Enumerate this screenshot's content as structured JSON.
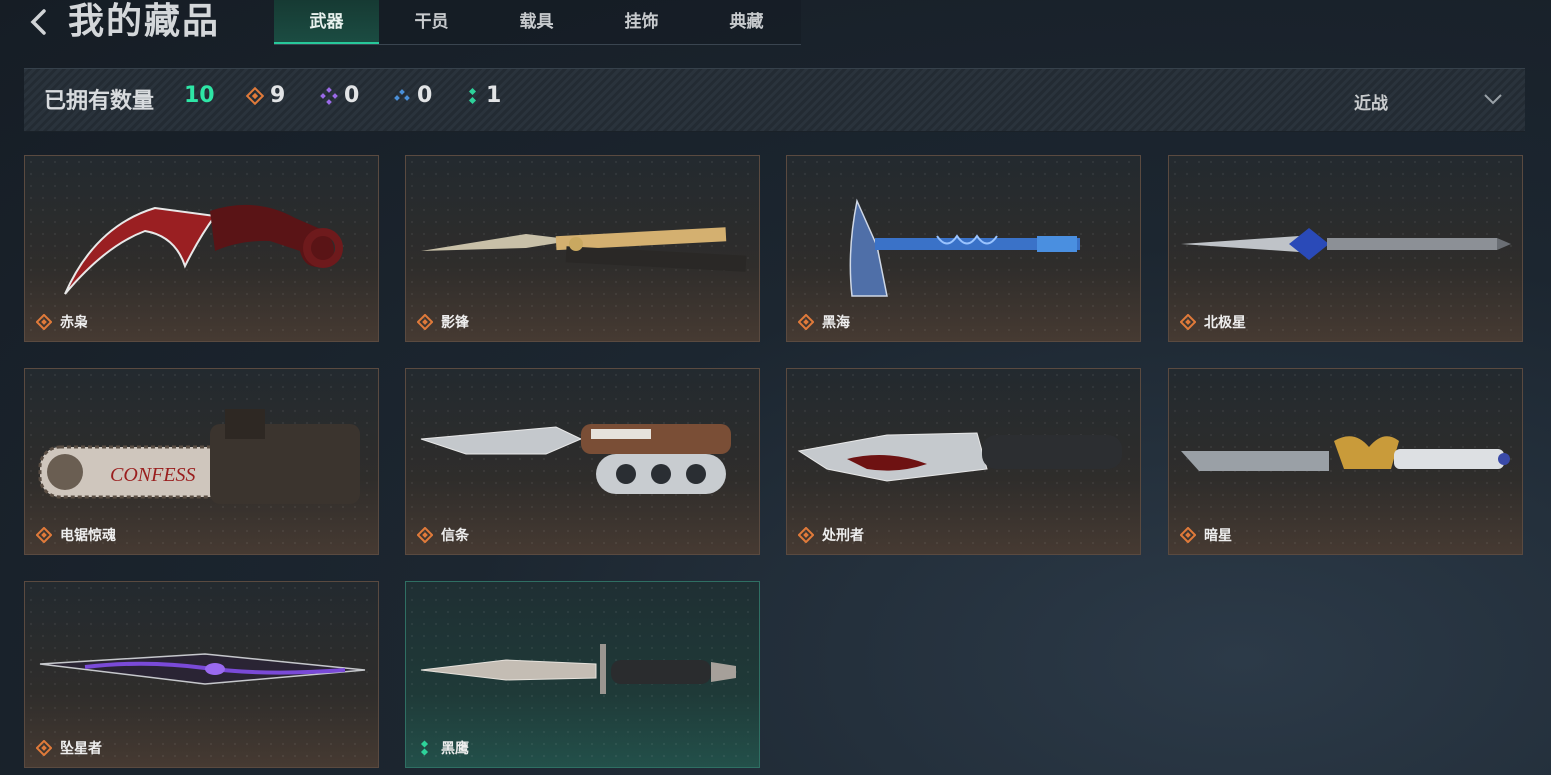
{
  "header": {
    "title": "我的藏品",
    "tabs": [
      {
        "label": "武器",
        "active": true
      },
      {
        "label": "干员",
        "active": false
      },
      {
        "label": "载具",
        "active": false
      },
      {
        "label": "挂饰",
        "active": false
      },
      {
        "label": "典藏",
        "active": false
      }
    ]
  },
  "stats": {
    "owned_label": "已拥有数量",
    "owned_count": "10",
    "rarity_counts": [
      {
        "icon": "orange-diamond-icon",
        "color": "#e07a3a",
        "count": "9"
      },
      {
        "icon": "purple-diamond-icon",
        "color": "#9b6ae8",
        "count": "0"
      },
      {
        "icon": "blue-diamond-icon",
        "color": "#4a8fd8",
        "count": "0"
      },
      {
        "icon": "green-dots-icon",
        "color": "#2ed29a",
        "count": "1"
      }
    ],
    "filter_value": "近战"
  },
  "items": [
    {
      "name": "赤枭",
      "rarity": "orange",
      "weapon_icon": "karambit-knife-icon"
    },
    {
      "name": "影锋",
      "rarity": "orange",
      "weapon_icon": "butterfly-knife-icon"
    },
    {
      "name": "黑海",
      "rarity": "orange",
      "weapon_icon": "tomahawk-axe-icon"
    },
    {
      "name": "北极星",
      "rarity": "orange",
      "weapon_icon": "dagger-icon"
    },
    {
      "name": "电锯惊魂",
      "rarity": "orange",
      "weapon_icon": "chainsaw-icon"
    },
    {
      "name": "信条",
      "rarity": "orange",
      "weapon_icon": "knuckle-knife-icon"
    },
    {
      "name": "处刑者",
      "rarity": "orange",
      "weapon_icon": "serrated-knife-icon"
    },
    {
      "name": "暗星",
      "rarity": "orange",
      "weapon_icon": "golden-blade-icon"
    },
    {
      "name": "坠星者",
      "rarity": "orange",
      "weapon_icon": "purple-blade-icon"
    },
    {
      "name": "黑鹰",
      "rarity": "green",
      "weapon_icon": "combat-knife-icon"
    }
  ],
  "colors": {
    "accent_green": "#2ee6a6",
    "rarity_orange": "#e07a3a",
    "rarity_green": "#2ed29a"
  }
}
